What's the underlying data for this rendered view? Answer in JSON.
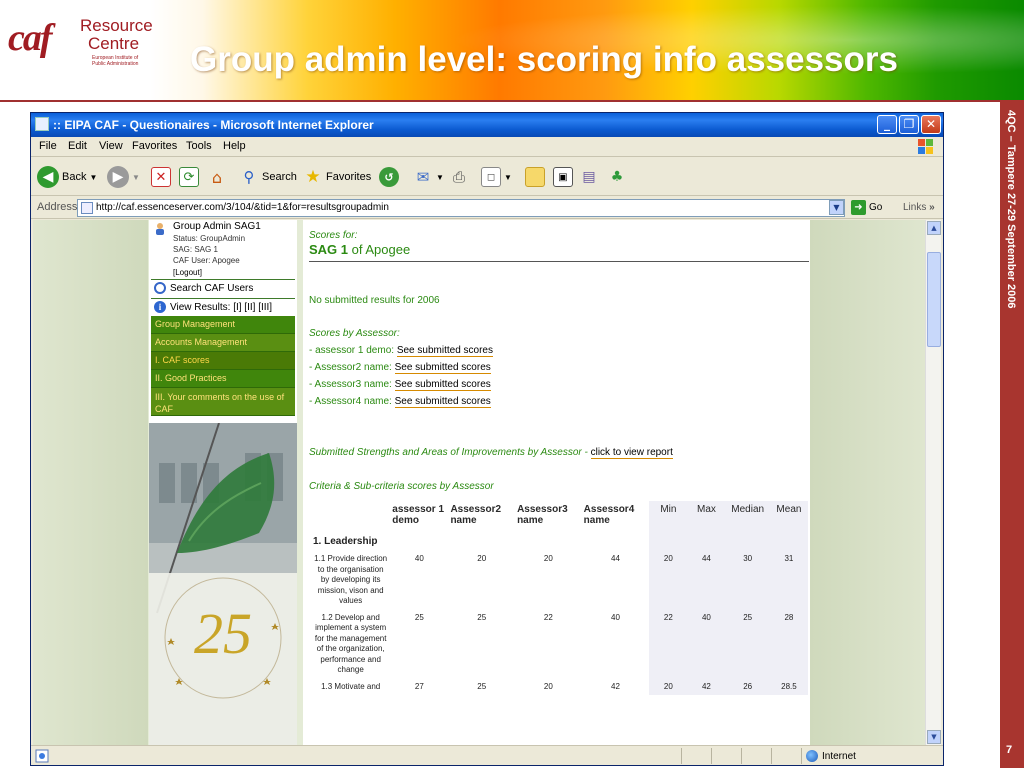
{
  "slide": {
    "title": "Group admin level: scoring info assessors",
    "side_caption": "4QC – Tampere 27-29 September 2006",
    "page_number": "7",
    "logo": {
      "mark": "caf",
      "name_line1": "Resource",
      "name_line2": "Centre",
      "subtitle": "European Institute of Public Administration"
    }
  },
  "browser": {
    "window_title": ":: EIPA CAF - Questionaires - Microsoft Internet Explorer",
    "menu": [
      "File",
      "Edit",
      "View",
      "Favorites",
      "Tools",
      "Help"
    ],
    "toolbar": {
      "back_label": "Back",
      "search_label": "Search",
      "favorites_label": "Favorites"
    },
    "address_label": "Address",
    "url": "http://caf.essenceserver.com/3/104/&tid=1&for=resultsgroupadmin",
    "go_label": "Go",
    "links_label": "Links",
    "status_zone": "Internet"
  },
  "sidebar": {
    "user_name": "Group Admin SAG1",
    "status_line": "Status: GroupAdmin",
    "sag_line": "SAG: SAG 1",
    "caf_user_line": "CAF User: Apogee",
    "logout_label": "[Logout]",
    "search_users_label": "Search CAF Users",
    "view_results_label": "View Results:",
    "view_results_links": "[I] [II] [III]",
    "menu_items": [
      "Group Management",
      "Accounts Management",
      "I. CAF scores",
      "II. Good Practices",
      "III. Your comments on the use of CAF"
    ]
  },
  "main": {
    "scores_for_label": "Scores for:",
    "sag_name": "SAG 1",
    "of_label": "of Apogee",
    "no_results_text": "No submitted results for 2006",
    "scores_by_assessor_label": "Scores by Assessor:",
    "assessors": [
      {
        "prefix": "- assessor 1 demo:",
        "link": "See submitted scores"
      },
      {
        "prefix": "- Assessor2 name:",
        "link": "See submitted scores"
      },
      {
        "prefix": "- Assessor3 name:",
        "link": "See submitted scores"
      },
      {
        "prefix": "- Assessor4 name:",
        "link": "See submitted scores"
      }
    ],
    "strengths_label": "Submitted Strengths and Areas of Improvements by Assessor -",
    "strengths_link": "click to view report",
    "criteria_label": "Criteria & Sub-criteria scores by Assessor"
  },
  "criteria_table": {
    "headers": [
      "assessor 1 demo",
      "Assessor2 name",
      "Assessor3 name",
      "Assessor4 name",
      "Min",
      "Max",
      "Median",
      "Mean"
    ],
    "criterion": "1. Leadership",
    "rows": [
      {
        "sub": "1.1 Provide direction to the organisation by developing its mission, vison and values",
        "values": [
          "40",
          "20",
          "20",
          "44",
          "20",
          "44",
          "30",
          "31"
        ]
      },
      {
        "sub": "1.2 Develop and implement a system for the management of the organization, performance and change",
        "values": [
          "25",
          "25",
          "22",
          "40",
          "22",
          "40",
          "25",
          "28"
        ]
      },
      {
        "sub": "1.3 Motivate and",
        "values": [
          "27",
          "25",
          "20",
          "42",
          "20",
          "42",
          "26",
          "28.5"
        ]
      }
    ]
  }
}
